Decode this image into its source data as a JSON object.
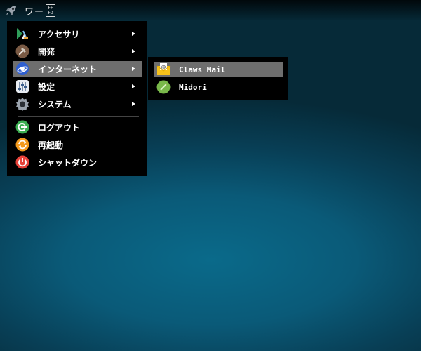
{
  "panel": {
    "workspace_label": "ワー",
    "unknown_glyph_top": "FF",
    "unknown_glyph_bottom": "FD"
  },
  "main_menu": {
    "items": [
      {
        "label": "アクセサリ",
        "icon": "accessories-icon",
        "has_submenu": true
      },
      {
        "label": "開発",
        "icon": "development-icon",
        "has_submenu": true
      },
      {
        "label": "インターネット",
        "icon": "internet-icon",
        "has_submenu": true,
        "selected": true
      },
      {
        "label": "設定",
        "icon": "settings-icon",
        "has_submenu": true
      },
      {
        "label": "システム",
        "icon": "system-icon",
        "has_submenu": true
      },
      {
        "label": "ログアウト",
        "icon": "logout-icon",
        "has_submenu": false
      },
      {
        "label": "再起動",
        "icon": "reboot-icon",
        "has_submenu": false
      },
      {
        "label": "シャットダウン",
        "icon": "shutdown-icon",
        "has_submenu": false
      }
    ]
  },
  "internet_submenu": {
    "items": [
      {
        "label": "Claws Mail",
        "icon": "claws-mail-icon",
        "selected": true
      },
      {
        "label": "Midori",
        "icon": "midori-icon",
        "selected": false
      }
    ]
  },
  "colors": {
    "menu_bg": "#000000",
    "selected_bg": "#6e6e6e",
    "text": "#ffffff"
  }
}
